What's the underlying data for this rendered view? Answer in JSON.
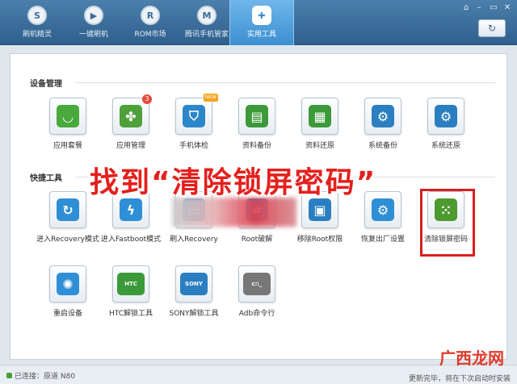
{
  "window": {
    "controls": [
      "⌂",
      "–",
      "▭",
      "✕"
    ],
    "refresh_icon": "↻"
  },
  "nav": {
    "tabs": [
      {
        "label": "刷机精灵",
        "glyph": "S"
      },
      {
        "label": "一键刷机",
        "glyph": "▶"
      },
      {
        "label": "ROM市场",
        "glyph": "R"
      },
      {
        "label": "腾讯手机管家",
        "glyph": "M"
      },
      {
        "label": "实用工具",
        "glyph": "✚",
        "active": true
      }
    ]
  },
  "sections": {
    "device": {
      "title": "设备管理",
      "items": [
        {
          "label": "应用套餐",
          "icon": "shopping-bag-icon",
          "glyph": "◡",
          "color": "#49a93c"
        },
        {
          "label": "应用管理",
          "icon": "puzzle-icon",
          "glyph": "✤",
          "color": "#4da03a",
          "badge": "3"
        },
        {
          "label": "手机体检",
          "icon": "shield-icon",
          "glyph": "⛉",
          "color": "#2b87c9",
          "badge_new": "NEW"
        },
        {
          "label": "资料备份",
          "icon": "document-copy-icon",
          "glyph": "▤",
          "color": "#3d9a3a"
        },
        {
          "label": "资料还原",
          "icon": "document-restore-icon",
          "glyph": "▦",
          "color": "#3d9a3a"
        },
        {
          "label": "系统备份",
          "icon": "system-backup-icon",
          "glyph": "⚙",
          "color": "#2b7fc0"
        },
        {
          "label": "系统还原",
          "icon": "system-restore-icon",
          "glyph": "⚙",
          "color": "#2b7fc0"
        }
      ]
    },
    "quick": {
      "title": "快捷工具",
      "items": [
        {
          "label": "进入Recovery模式",
          "icon": "recovery-refresh-icon",
          "glyph": "↻",
          "color": "#2f8fd6"
        },
        {
          "label": "进入Fastboot模式",
          "icon": "lightning-icon",
          "glyph": "ϟ",
          "color": "#2f8fd6"
        },
        {
          "label": "刷入Recovery",
          "icon": "flash-recovery-icon",
          "glyph": "▭",
          "color": "#2f8fd6"
        },
        {
          "label": "Root破解",
          "icon": "root-icon",
          "glyph": "#",
          "color": "#2f8fd6"
        },
        {
          "label": "移除Root权限",
          "icon": "android-icon",
          "glyph": "▣",
          "color": "#2b7fc0"
        },
        {
          "label": "恢复出厂设置",
          "icon": "gears-icon",
          "glyph": "⚙",
          "color": "#2f8fd6"
        },
        {
          "label": "清除锁屏密码",
          "icon": "pattern-lock-icon",
          "glyph": "⁙",
          "color": "#4d9a2f"
        }
      ],
      "items2": [
        {
          "label": "重启设备",
          "icon": "reboot-spinner-icon",
          "glyph": "✺",
          "color": "#2f8fd6"
        },
        {
          "label": "HTC解锁工具",
          "icon": "htc-unlock-icon",
          "glyph": "HTC",
          "color": "#3a9a3a"
        },
        {
          "label": "SONY解锁工具",
          "icon": "sony-unlock-icon",
          "glyph": "SONY",
          "color": "#2b7fc0"
        },
        {
          "label": "Adb命令行",
          "icon": "terminal-icon",
          "glyph": "c:\\_",
          "color": "#777777"
        }
      ]
    }
  },
  "overlay": {
    "text": "找到“清除锁屏密码”"
  },
  "status": {
    "connected": "已连接：原道 N80",
    "update_note": "更新完毕，将在下次启动时安装",
    "watermark": "广西龙网"
  }
}
